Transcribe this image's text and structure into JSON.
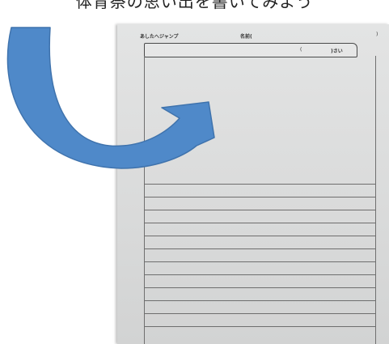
{
  "caption": "体育祭の思い出を書いてみよう",
  "worksheet": {
    "title": "あしたへジャンプ",
    "name_label": "名前(",
    "name_close": ")",
    "age_paren": "(",
    "age_label": ")さい"
  },
  "colors": {
    "arrow_fill": "#4f89c9",
    "arrow_stroke": "#3f73ad",
    "paper": "#dedfdf"
  },
  "writing_lines_count": 12
}
